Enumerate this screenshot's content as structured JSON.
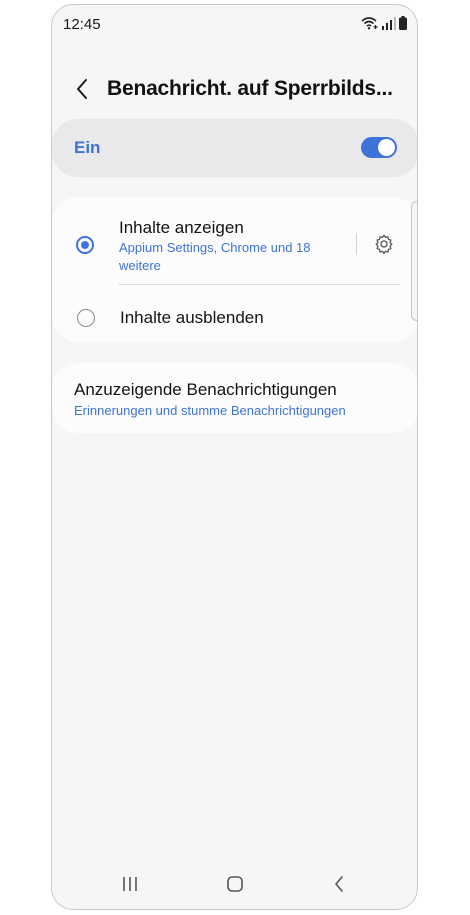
{
  "status_bar": {
    "time": "12:45",
    "icons": [
      "wifi-icon",
      "signal-icon",
      "battery-icon"
    ]
  },
  "header": {
    "title": "Benachricht. auf Sperrbilds...",
    "back_icon": "chevron-left-icon"
  },
  "master_switch": {
    "label": "Ein",
    "on": true
  },
  "options": [
    {
      "title": "Inhalte anzeigen",
      "subtitle": "Appium Settings, Chrome und 18 weitere",
      "selected": true,
      "settings_icon": "gear-icon"
    },
    {
      "title": "Inhalte ausblenden",
      "selected": false
    }
  ],
  "notifications_to_show": {
    "title": "Anzuzeigende Benachrichtigungen",
    "subtitle": "Erinnerungen und stumme Benachrichtigungen"
  },
  "nav_bar": {
    "icons": [
      "recents-icon",
      "home-icon",
      "back-icon"
    ]
  },
  "colors": {
    "accent": "#3e73d9",
    "background": "#f6f6f8",
    "card": "#fcfcfd",
    "master_card": "#e9e9ec"
  }
}
